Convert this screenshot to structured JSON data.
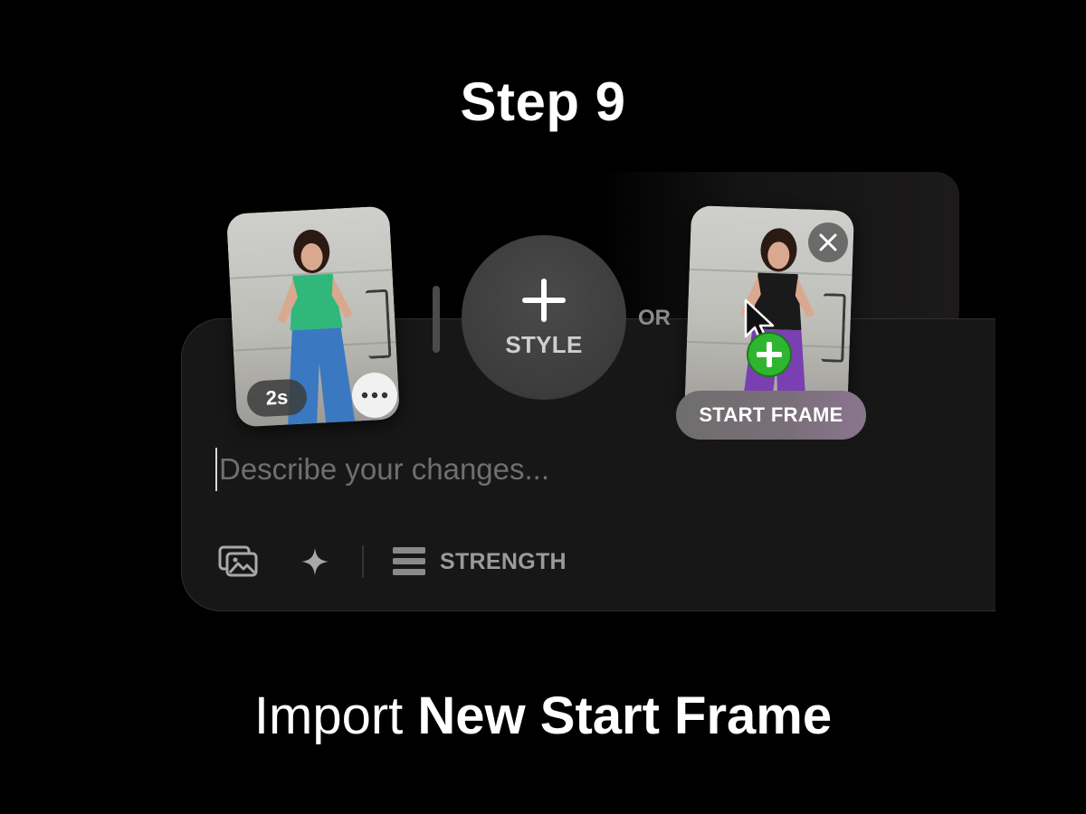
{
  "header": {
    "title": "Step 9"
  },
  "editor": {
    "left_clip": {
      "duration": "2s",
      "more_icon": "ellipsis-icon"
    },
    "style_button": {
      "icon": "plus-icon",
      "label": "STYLE"
    },
    "or_label": "OR",
    "right_clip": {
      "close_icon": "close-icon",
      "chip_label": "START FRAME",
      "drop_icon": "add-icon"
    },
    "prompt": {
      "placeholder": "Describe your changes..."
    },
    "toolbar": {
      "image_icon": "images-icon",
      "sparkle_icon": "sparkle-icon",
      "strength_icon": "strength-bars-icon",
      "strength_label": "STRENGTH"
    }
  },
  "caption": {
    "prefix": "Import",
    "emphasis": "New Start Frame"
  },
  "colors": {
    "background": "#000000",
    "panel": "#171717",
    "drop_badge": "#2fb52f",
    "left_top": "#2fb87a",
    "left_pants": "#3a78c2",
    "right_top": "#1a1a1a",
    "right_pants": "#7a3fb0"
  }
}
